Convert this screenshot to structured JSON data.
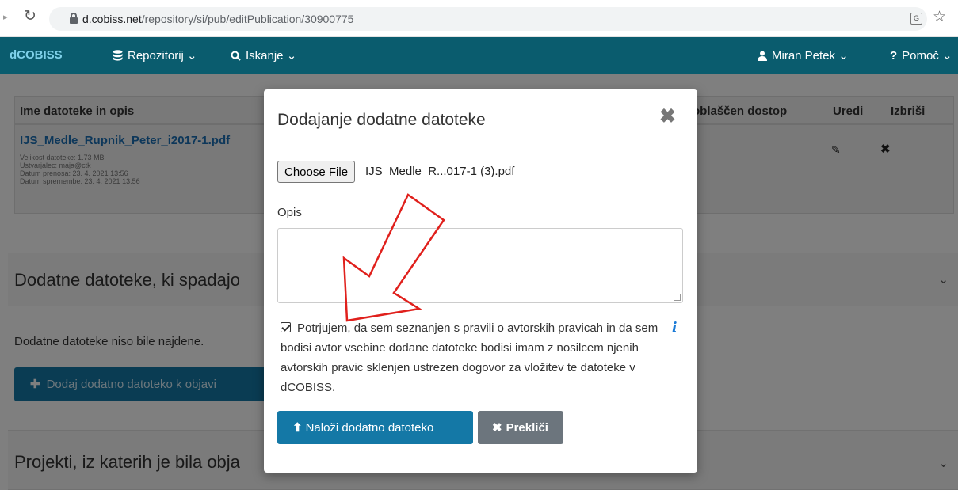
{
  "browser": {
    "url_host": "d.cobiss.net",
    "url_path": "/repository/si/pub/editPublication/30900775"
  },
  "navbar": {
    "brand": "dCOBISS",
    "repo_label": "Repozitorij ⌄",
    "search_label": "Iskanje ⌄",
    "user_label": "Miran Petek ⌄",
    "help_label": "Pomoč ⌄"
  },
  "files_table": {
    "col_name": "Ime datoteke in opis",
    "col_access": "oblaščen dostop",
    "col_edit": "Uredi",
    "col_delete": "Izbriši",
    "row": {
      "filename": "IJS_Medle_Rupnik_Peter_i2017-1.pdf",
      "size": "Velikost datoteke: 1.73 MB",
      "creator": "Ustvarjalec: maja@ctk",
      "uploaded": "Datum prenosa: 23. 4. 2021 13:56",
      "modified": "Datum spremembe: 23. 4. 2021 13:56"
    }
  },
  "sections": {
    "additional_title": "Dodatne datoteke, ki spadajo",
    "no_files": "Dodatne datoteke niso bile najdene.",
    "add_button": "Dodaj dodatno datoteko k objavi",
    "projects_title": "Projekti, iz katerih je bila obja"
  },
  "modal": {
    "title": "Dodajanje dodatne datoteke",
    "choose_file": "Choose File",
    "file_name": "IJS_Medle_R...017-1 (3).pdf",
    "opis_label": "Opis",
    "consent_text": "Potrjujem, da sem seznanjen s pravili o avtorskih pravicah in da sem bodisi avtor vsebine dodane datoteke bodisi imam z nosilcem njenih avtorskih pravic sklenjen ustrezen dogovor za vložitev te datoteke v dCOBISS.",
    "upload_button": "Naloži dodatno datoteko",
    "cancel_button": "Prekliči"
  },
  "colors": {
    "navbar": "#0a5c6e",
    "primary": "#1478a6",
    "secondary": "#6c757d",
    "annotation": "#e0201c"
  }
}
